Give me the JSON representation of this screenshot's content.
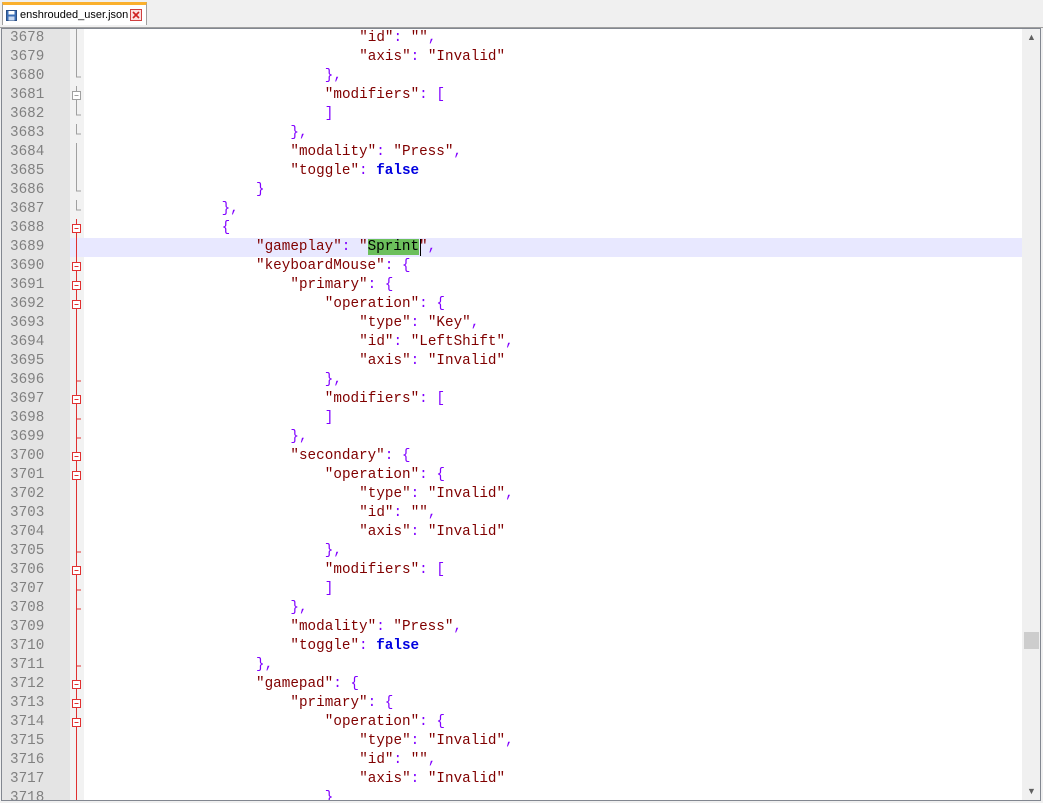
{
  "tab": {
    "filename": "enshrouded_user.json"
  },
  "editor": {
    "lines": [
      {
        "num": "3678",
        "indent": 32,
        "segs": [
          {
            "c": "s",
            "t": "\"id\""
          },
          {
            "c": "p",
            "t": ": "
          },
          {
            "c": "s",
            "t": "\"\""
          },
          {
            "c": "p",
            "t": ","
          }
        ],
        "fold": "line"
      },
      {
        "num": "3679",
        "indent": 32,
        "segs": [
          {
            "c": "s",
            "t": "\"axis\""
          },
          {
            "c": "p",
            "t": ": "
          },
          {
            "c": "s",
            "t": "\"Invalid\""
          }
        ],
        "fold": "line"
      },
      {
        "num": "3680",
        "indent": 28,
        "segs": [
          {
            "c": "p",
            "t": "},"
          }
        ],
        "fold": "end"
      },
      {
        "num": "3681",
        "indent": 28,
        "segs": [
          {
            "c": "s",
            "t": "\"modifiers\""
          },
          {
            "c": "p",
            "t": ": ["
          }
        ],
        "fold": "box"
      },
      {
        "num": "3682",
        "indent": 28,
        "segs": [
          {
            "c": "p",
            "t": "]"
          }
        ],
        "fold": "end"
      },
      {
        "num": "3683",
        "indent": 24,
        "segs": [
          {
            "c": "p",
            "t": "},"
          }
        ],
        "fold": "end"
      },
      {
        "num": "3684",
        "indent": 24,
        "segs": [
          {
            "c": "s",
            "t": "\"modality\""
          },
          {
            "c": "p",
            "t": ": "
          },
          {
            "c": "s",
            "t": "\"Press\""
          },
          {
            "c": "p",
            "t": ","
          }
        ],
        "fold": "line"
      },
      {
        "num": "3685",
        "indent": 24,
        "segs": [
          {
            "c": "s",
            "t": "\"toggle\""
          },
          {
            "c": "p",
            "t": ": "
          },
          {
            "c": "k",
            "t": "false"
          }
        ],
        "fold": "line"
      },
      {
        "num": "3686",
        "indent": 20,
        "segs": [
          {
            "c": "p",
            "t": "}"
          }
        ],
        "fold": "end"
      },
      {
        "num": "3687",
        "indent": 16,
        "segs": [
          {
            "c": "p",
            "t": "},"
          }
        ],
        "fold": "end"
      },
      {
        "num": "3688",
        "indent": 16,
        "segs": [
          {
            "c": "p",
            "t": "{"
          }
        ],
        "fold": "boxred"
      },
      {
        "num": "3689",
        "indent": 20,
        "segs": [
          {
            "c": "s",
            "t": "\"gameplay\""
          },
          {
            "c": "p",
            "t": ": "
          },
          {
            "c": "s",
            "t": "\""
          },
          {
            "c": "sel",
            "t": "Sprint"
          },
          {
            "c": "s",
            "t": "\""
          },
          {
            "c": "p",
            "t": ","
          }
        ],
        "fold": "redline",
        "current": true
      },
      {
        "num": "3690",
        "indent": 20,
        "segs": [
          {
            "c": "s",
            "t": "\"keyboardMouse\""
          },
          {
            "c": "p",
            "t": ": {"
          }
        ],
        "fold": "boxred"
      },
      {
        "num": "3691",
        "indent": 24,
        "segs": [
          {
            "c": "s",
            "t": "\"primary\""
          },
          {
            "c": "p",
            "t": ": {"
          }
        ],
        "fold": "boxred"
      },
      {
        "num": "3692",
        "indent": 28,
        "segs": [
          {
            "c": "s",
            "t": "\"operation\""
          },
          {
            "c": "p",
            "t": ": {"
          }
        ],
        "fold": "boxred"
      },
      {
        "num": "3693",
        "indent": 32,
        "segs": [
          {
            "c": "s",
            "t": "\"type\""
          },
          {
            "c": "p",
            "t": ": "
          },
          {
            "c": "s",
            "t": "\"Key\""
          },
          {
            "c": "p",
            "t": ","
          }
        ],
        "fold": "redline"
      },
      {
        "num": "3694",
        "indent": 32,
        "segs": [
          {
            "c": "s",
            "t": "\"id\""
          },
          {
            "c": "p",
            "t": ": "
          },
          {
            "c": "s",
            "t": "\"LeftShift\""
          },
          {
            "c": "p",
            "t": ","
          }
        ],
        "fold": "redline"
      },
      {
        "num": "3695",
        "indent": 32,
        "segs": [
          {
            "c": "s",
            "t": "\"axis\""
          },
          {
            "c": "p",
            "t": ": "
          },
          {
            "c": "s",
            "t": "\"Invalid\""
          }
        ],
        "fold": "redline"
      },
      {
        "num": "3696",
        "indent": 28,
        "segs": [
          {
            "c": "p",
            "t": "},"
          }
        ],
        "fold": "redend"
      },
      {
        "num": "3697",
        "indent": 28,
        "segs": [
          {
            "c": "s",
            "t": "\"modifiers\""
          },
          {
            "c": "p",
            "t": ": ["
          }
        ],
        "fold": "boxred"
      },
      {
        "num": "3698",
        "indent": 28,
        "segs": [
          {
            "c": "p",
            "t": "]"
          }
        ],
        "fold": "redend"
      },
      {
        "num": "3699",
        "indent": 24,
        "segs": [
          {
            "c": "p",
            "t": "},"
          }
        ],
        "fold": "redend"
      },
      {
        "num": "3700",
        "indent": 24,
        "segs": [
          {
            "c": "s",
            "t": "\"secondary\""
          },
          {
            "c": "p",
            "t": ": {"
          }
        ],
        "fold": "boxred"
      },
      {
        "num": "3701",
        "indent": 28,
        "segs": [
          {
            "c": "s",
            "t": "\"operation\""
          },
          {
            "c": "p",
            "t": ": {"
          }
        ],
        "fold": "boxred"
      },
      {
        "num": "3702",
        "indent": 32,
        "segs": [
          {
            "c": "s",
            "t": "\"type\""
          },
          {
            "c": "p",
            "t": ": "
          },
          {
            "c": "s",
            "t": "\"Invalid\""
          },
          {
            "c": "p",
            "t": ","
          }
        ],
        "fold": "redline"
      },
      {
        "num": "3703",
        "indent": 32,
        "segs": [
          {
            "c": "s",
            "t": "\"id\""
          },
          {
            "c": "p",
            "t": ": "
          },
          {
            "c": "s",
            "t": "\"\""
          },
          {
            "c": "p",
            "t": ","
          }
        ],
        "fold": "redline"
      },
      {
        "num": "3704",
        "indent": 32,
        "segs": [
          {
            "c": "s",
            "t": "\"axis\""
          },
          {
            "c": "p",
            "t": ": "
          },
          {
            "c": "s",
            "t": "\"Invalid\""
          }
        ],
        "fold": "redline"
      },
      {
        "num": "3705",
        "indent": 28,
        "segs": [
          {
            "c": "p",
            "t": "},"
          }
        ],
        "fold": "redend"
      },
      {
        "num": "3706",
        "indent": 28,
        "segs": [
          {
            "c": "s",
            "t": "\"modifiers\""
          },
          {
            "c": "p",
            "t": ": ["
          }
        ],
        "fold": "boxred"
      },
      {
        "num": "3707",
        "indent": 28,
        "segs": [
          {
            "c": "p",
            "t": "]"
          }
        ],
        "fold": "redend"
      },
      {
        "num": "3708",
        "indent": 24,
        "segs": [
          {
            "c": "p",
            "t": "},"
          }
        ],
        "fold": "redend"
      },
      {
        "num": "3709",
        "indent": 24,
        "segs": [
          {
            "c": "s",
            "t": "\"modality\""
          },
          {
            "c": "p",
            "t": ": "
          },
          {
            "c": "s",
            "t": "\"Press\""
          },
          {
            "c": "p",
            "t": ","
          }
        ],
        "fold": "redline"
      },
      {
        "num": "3710",
        "indent": 24,
        "segs": [
          {
            "c": "s",
            "t": "\"toggle\""
          },
          {
            "c": "p",
            "t": ": "
          },
          {
            "c": "k",
            "t": "false"
          }
        ],
        "fold": "redline"
      },
      {
        "num": "3711",
        "indent": 20,
        "segs": [
          {
            "c": "p",
            "t": "},"
          }
        ],
        "fold": "redend"
      },
      {
        "num": "3712",
        "indent": 20,
        "segs": [
          {
            "c": "s",
            "t": "\"gamepad\""
          },
          {
            "c": "p",
            "t": ": {"
          }
        ],
        "fold": "boxred"
      },
      {
        "num": "3713",
        "indent": 24,
        "segs": [
          {
            "c": "s",
            "t": "\"primary\""
          },
          {
            "c": "p",
            "t": ": {"
          }
        ],
        "fold": "boxred"
      },
      {
        "num": "3714",
        "indent": 28,
        "segs": [
          {
            "c": "s",
            "t": "\"operation\""
          },
          {
            "c": "p",
            "t": ": {"
          }
        ],
        "fold": "boxred"
      },
      {
        "num": "3715",
        "indent": 32,
        "segs": [
          {
            "c": "s",
            "t": "\"type\""
          },
          {
            "c": "p",
            "t": ": "
          },
          {
            "c": "s",
            "t": "\"Invalid\""
          },
          {
            "c": "p",
            "t": ","
          }
        ],
        "fold": "redline"
      },
      {
        "num": "3716",
        "indent": 32,
        "segs": [
          {
            "c": "s",
            "t": "\"id\""
          },
          {
            "c": "p",
            "t": ": "
          },
          {
            "c": "s",
            "t": "\"\""
          },
          {
            "c": "p",
            "t": ","
          }
        ],
        "fold": "redline"
      },
      {
        "num": "3717",
        "indent": 32,
        "segs": [
          {
            "c": "s",
            "t": "\"axis\""
          },
          {
            "c": "p",
            "t": ": "
          },
          {
            "c": "s",
            "t": "\"Invalid\""
          }
        ],
        "fold": "redline"
      },
      {
        "num": "3718",
        "indent": 28,
        "segs": [
          {
            "c": "p",
            "t": "}"
          }
        ],
        "fold": "redline"
      }
    ]
  },
  "scrollbar": {
    "up_icon": "chevron-up-icon",
    "down_icon": "chevron-down-icon"
  },
  "colors": {
    "string": "#800000",
    "operator": "#8000ff",
    "keyword": "#0000e0",
    "selection": "#6cbf5c",
    "current_line": "#e8e8ff",
    "fold_red": "#e03030",
    "tab_accent": "#fab02d"
  }
}
